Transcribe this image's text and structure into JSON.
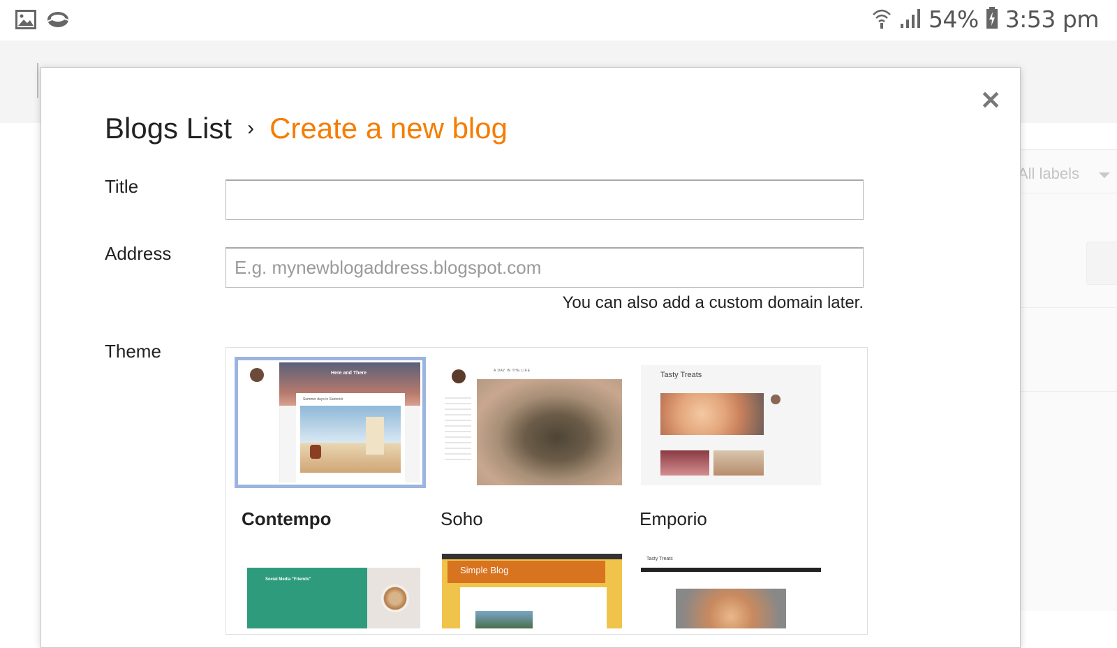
{
  "status_bar": {
    "battery": "54%",
    "time": "3:53 pm",
    "left_icons": [
      "image-icon",
      "cloud-icon"
    ],
    "right_icons": [
      "wifi-icon",
      "signal-icon",
      "battery-icon"
    ]
  },
  "background": {
    "labels_filter": "All labels"
  },
  "dialog": {
    "breadcrumb": {
      "root": "Blogs List",
      "separator": "›",
      "current": "Create a new blog"
    },
    "title_label": "Title",
    "title_value": "",
    "address_label": "Address",
    "address_placeholder": "E.g. mynewblogaddress.blogspot.com",
    "address_hint": "You can also add a custom domain later.",
    "theme_label": "Theme",
    "themes": [
      {
        "name": "Contempo",
        "selected": true,
        "thumb_text": [
          "Here and There",
          "Summer days in Santorini"
        ]
      },
      {
        "name": "Soho",
        "selected": false,
        "thumb_text": [
          "A DAY IN THE LIFE"
        ]
      },
      {
        "name": "Emporio",
        "selected": false,
        "thumb_text": [
          "Tasty Treats"
        ]
      },
      {
        "name": "",
        "selected": false,
        "thumb_text": [
          "Social Media \"Friends\""
        ]
      },
      {
        "name": "",
        "selected": false,
        "thumb_text": [
          "Simple Blog"
        ]
      },
      {
        "name": "",
        "selected": false,
        "thumb_text": [
          "Tasty Treats"
        ]
      }
    ]
  },
  "colors": {
    "accent": "#f57d00",
    "selection": "#9bb4e0"
  }
}
